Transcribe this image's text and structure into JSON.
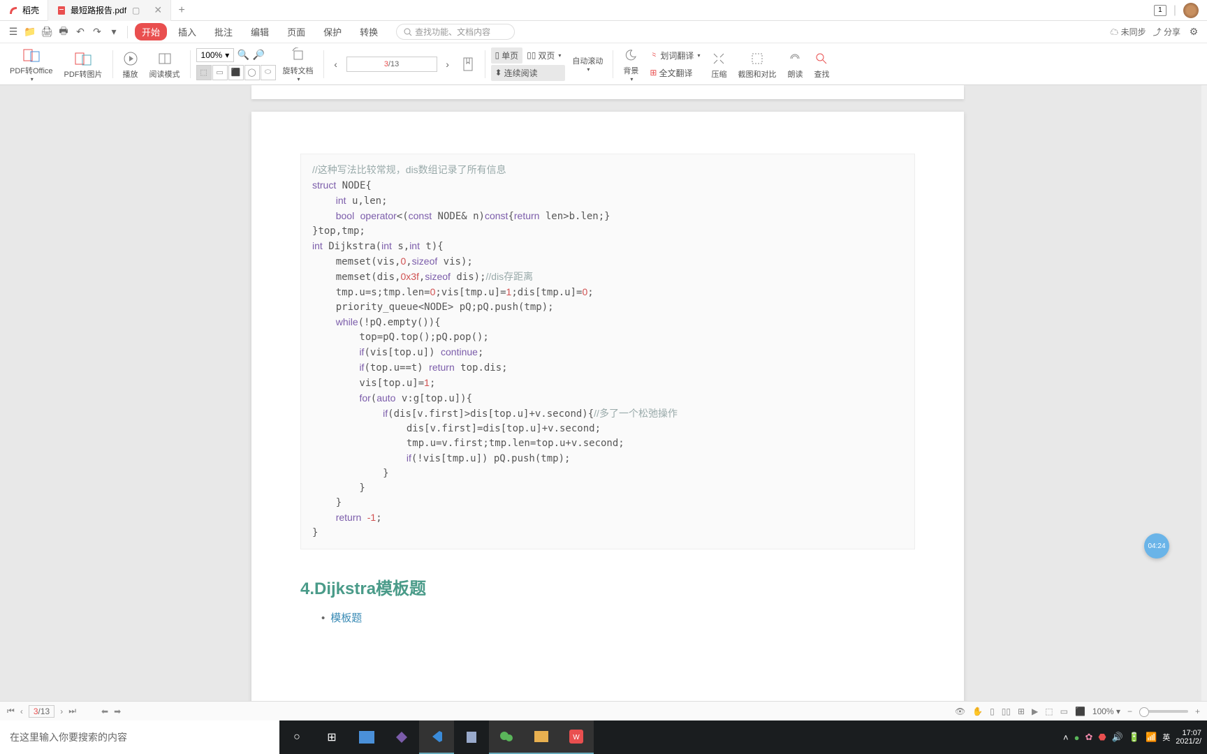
{
  "tabs": {
    "home": {
      "label": "稻壳"
    },
    "doc": {
      "label": "最短路报告.pdf"
    }
  },
  "titlebar": {
    "badge": "1"
  },
  "menu": {
    "start": "开始",
    "insert": "插入",
    "annotate": "批注",
    "edit": "编辑",
    "page": "页面",
    "protect": "保护",
    "convert": "转换",
    "search_placeholder": "查找功能、文档内容",
    "unsynced": "未同步",
    "share": "分享"
  },
  "ribbon": {
    "pdf2office": "PDF转Office",
    "pdf2img": "PDF转图片",
    "play": "播放",
    "readmode": "阅读模式",
    "zoom": "100%",
    "rotate": "旋转文档",
    "page_cur": "3",
    "page_total": "/13",
    "single": "单页",
    "double": "双页",
    "continuous": "连续阅读",
    "autoscroll": "自动滚动",
    "background": "背景",
    "word_translate": "划词翻译",
    "full_translate": "全文翻译",
    "compress": "压缩",
    "screenshot": "截图和对比",
    "read_aloud": "朗读",
    "find": "查找"
  },
  "document": {
    "code_comment1": "//这种写法比较常规，dis数组记录了所有信息",
    "code_lines": [
      "struct NODE{",
      "    int u,len;",
      "    bool operator<(const NODE& n)const{return len>b.len;}",
      "}top,tmp;",
      "int Dijkstra(int s,int t){",
      "    memset(vis,0,sizeof vis);",
      "    memset(dis,0x3f,sizeof dis);//dis存距离",
      "    tmp.u=s;tmp.len=0;vis[tmp.u]=1;dis[tmp.u]=0;",
      "    priority_queue<NODE> pQ;pQ.push(tmp);",
      "    while(!pQ.empty()){",
      "        top=pQ.top();pQ.pop();",
      "        if(vis[top.u]) continue;",
      "        if(top.u==t) return top.dis;",
      "        vis[top.u]=1;",
      "        for(auto v:g[top.u]){",
      "            if(dis[v.first]>dis[top.u]+v.second){//多了一个松弛操作",
      "                dis[v.first]=dis[top.u]+v.second;",
      "                tmp.u=v.first;tmp.len=top.u+v.second;",
      "                if(!vis[tmp.u]) pQ.push(tmp);",
      "            }",
      "        }",
      "    }",
      "    return -1;",
      "}"
    ],
    "heading": "4.Dijkstra模板题",
    "link": "模板题"
  },
  "timer": "04:24",
  "statusbar": {
    "page_cur": "3",
    "page_total": "/13",
    "zoom": "100%"
  },
  "taskbar": {
    "search_placeholder": "在这里输入你要搜索的内容",
    "ime": "英",
    "time": "17:07",
    "date": "2021/2/"
  }
}
